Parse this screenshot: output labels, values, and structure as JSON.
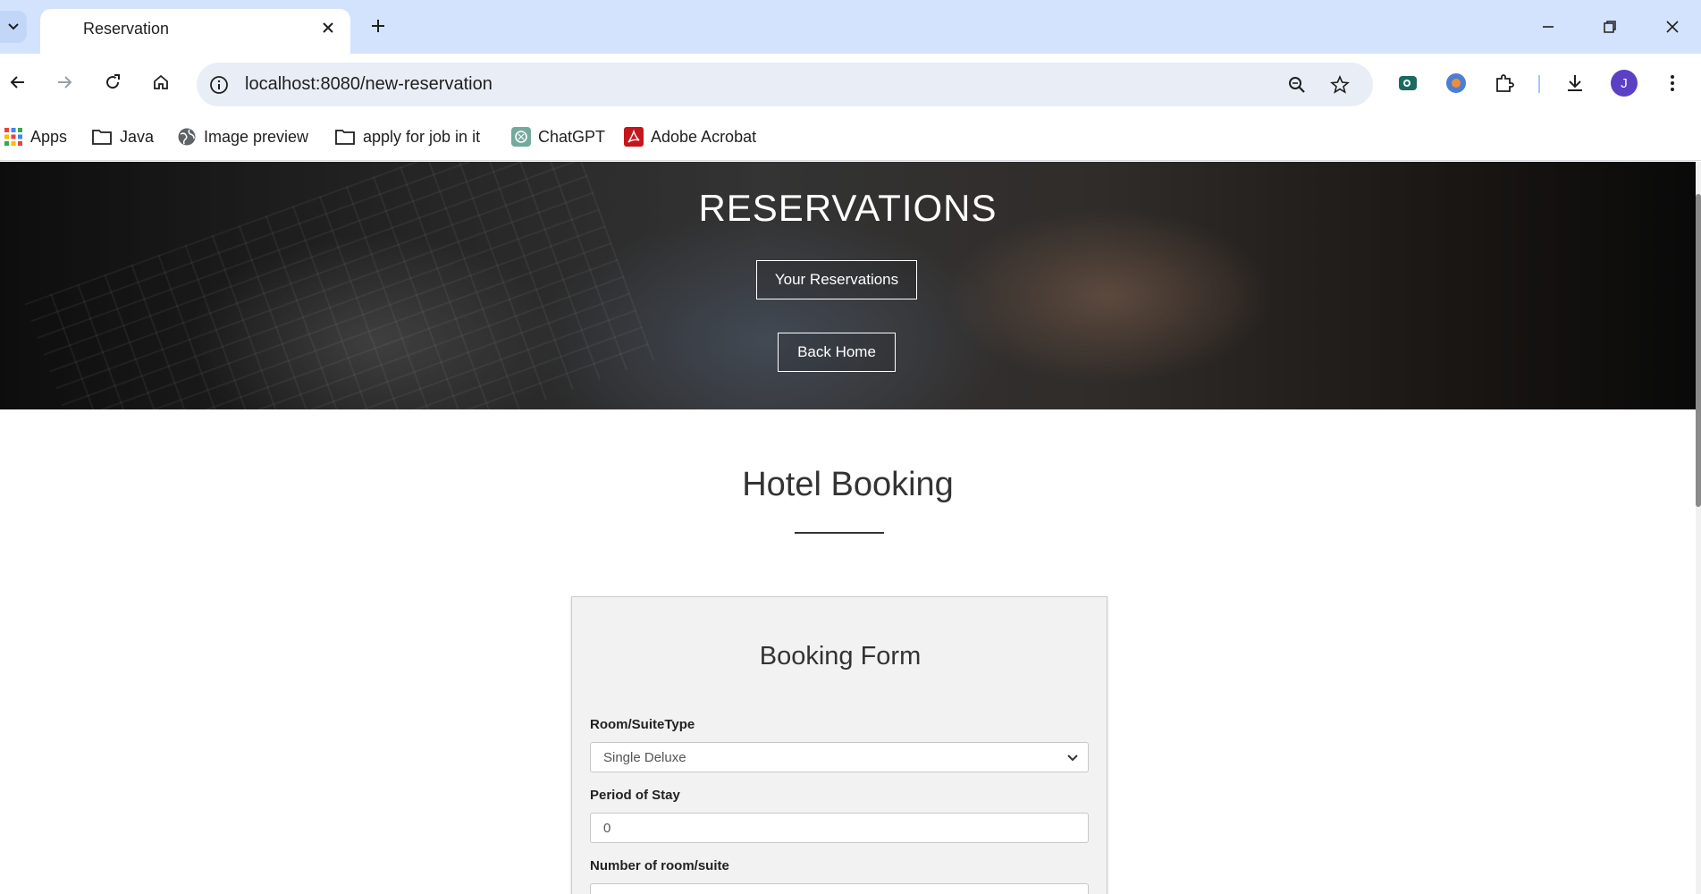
{
  "browser": {
    "tab_title": "Reservation",
    "url": "localhost:8080/new-reservation",
    "profile_initial": "J"
  },
  "bookmarks": [
    {
      "label": "Apps",
      "icon": "apps-grid-icon"
    },
    {
      "label": "Java",
      "icon": "folder-icon"
    },
    {
      "label": "Image preview",
      "icon": "globe-icon"
    },
    {
      "label": "apply for job in it",
      "icon": "folder-icon"
    },
    {
      "label": "ChatGPT",
      "icon": "chatgpt-icon"
    },
    {
      "label": "Adobe Acrobat",
      "icon": "acrobat-icon"
    }
  ],
  "hero": {
    "title": "RESERVATIONS",
    "your_reservations_label": "Your Reservations",
    "back_home_label": "Back Home"
  },
  "section": {
    "title": "Hotel Booking"
  },
  "form": {
    "title": "Booking Form",
    "room_type_label": "Room/SuiteType",
    "room_type_value": "Single Deluxe",
    "period_label": "Period of Stay",
    "period_value": "0",
    "rooms_label": "Number of room/suite"
  },
  "colors": {
    "tabbar_bg": "#d3e3fd",
    "omnibox_bg": "#e9eef6",
    "profile_avatar": "#5b3fc4",
    "form_bg": "#f2f2f2"
  }
}
